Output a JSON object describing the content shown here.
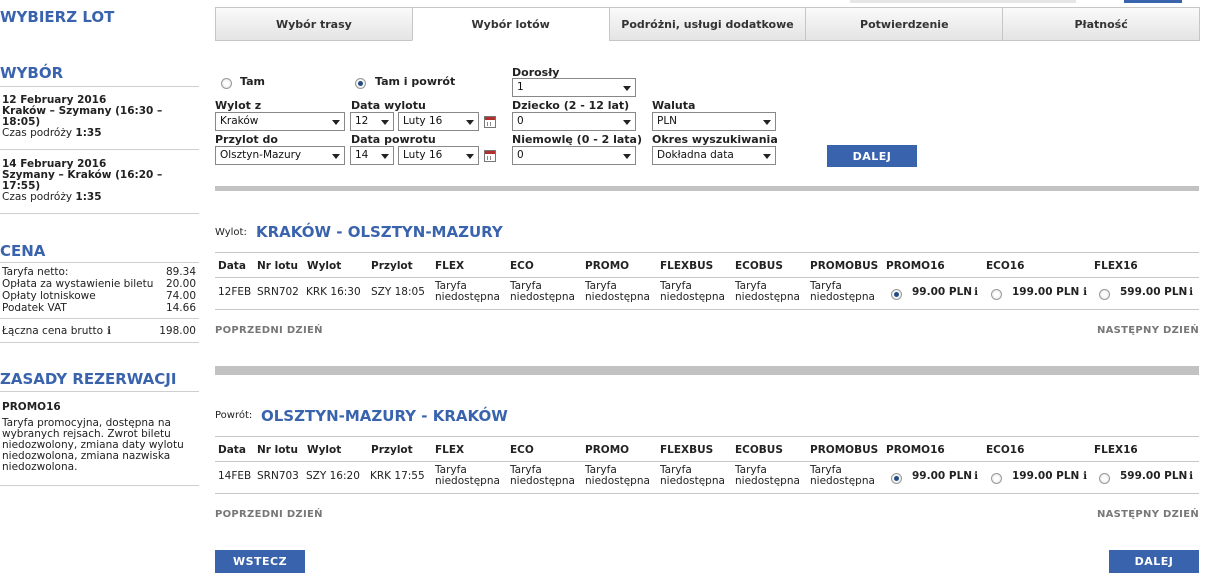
{
  "sidebar": {
    "title": "WYBIERZ LOT",
    "choice_heading": "WYBÓR",
    "legs": [
      {
        "date": "12 February 2016",
        "route": "Kraków – Szymany  (16:30 –",
        "route2": "18:05)",
        "duration_label": "Czas podróży",
        "duration": "1:35"
      },
      {
        "date": "14 February 2016",
        "route": "Szymany – Kraków  (16:20 –",
        "route2": "17:55)",
        "duration_label": "Czas podróży",
        "duration": "1:35"
      }
    ],
    "price_heading": "CENA",
    "price_rows": [
      {
        "label": "Taryfa netto:",
        "value": "89.34"
      },
      {
        "label": "Opłata za wystawienie biletu",
        "value": "20.00"
      },
      {
        "label": "Opłaty lotniskowe",
        "value": "74.00"
      },
      {
        "label": "Podatek VAT",
        "value": "14.66"
      }
    ],
    "total_label": "Łączna cena brutto",
    "total_value": "198.00",
    "rules_heading": "ZASADY REZERWACJI",
    "rules_fare": "PROMO16",
    "rules_text": [
      "Taryfa promocyjna, dostępna na",
      "wybranych rejsach. Zwrot biletu",
      "niedozwolony, zmiana daty wylotu",
      "niedozwolona, zmiana nazwiska",
      "niedozwolona."
    ]
  },
  "tabs": [
    "Wybór trasy",
    "Wybór lotów",
    "Podróżni, usługi dodatkowe",
    "Potwierdzenie",
    "Płatność"
  ],
  "active_tab": 1,
  "search": {
    "trip_oneway": "Tam",
    "trip_return": "Tam i powrót",
    "from_label": "Wylot z",
    "from_value": "Kraków",
    "to_label": "Przylot do",
    "to_value": "Olsztyn-Mazury",
    "dep_label": "Data wylotu",
    "dep_day": "12",
    "dep_month": "Luty 16",
    "ret_label": "Data powrotu",
    "ret_day": "14",
    "ret_month": "Luty 16",
    "adult_label": "Dorosły",
    "adult_value": "1",
    "child_label": "Dziecko (2 - 12 lat)",
    "child_value": "0",
    "infant_label": "Niemowlę (0 - 2 lata)",
    "infant_value": "0",
    "currency_label": "Waluta",
    "currency_value": "PLN",
    "period_label": "Okres wyszukiwania",
    "period_value": "Dokładna data",
    "submit": "DALEJ"
  },
  "columns": [
    "Data",
    "Nr lotu",
    "Wylot",
    "Przylot",
    "FLEX",
    "ECO",
    "PROMO",
    "FLEXBUS",
    "ECOBUS",
    "PROMOBUS",
    "PROMO16",
    "ECO16",
    "FLEX16"
  ],
  "unavailable": [
    "Taryfa",
    "niedostępna"
  ],
  "outbound": {
    "label": "Wylot:",
    "route": "KRAKÓW - OLSZTYN-MAZURY",
    "date": "12FEB",
    "flight": "SRN702",
    "dep": "KRK 16:30",
    "arr": "SZY 18:05",
    "prices": [
      "99.00 PLN",
      "199.00 PLN",
      "599.00 PLN"
    ],
    "selected": 0
  },
  "inbound": {
    "label": "Powrót:",
    "route": "OLSZTYN-MAZURY - KRAKÓW",
    "date": "14FEB",
    "flight": "SRN703",
    "dep": "SZY 16:20",
    "arr": "KRK 17:55",
    "prices": [
      "99.00 PLN",
      "199.00 PLN",
      "599.00 PLN"
    ],
    "selected": 0
  },
  "prev_day": "POPRZEDNI DZIEŃ",
  "next_day": "NASTĘPNY DZIEŃ",
  "back": "WSTECZ",
  "next": "DALEJ",
  "colors": {
    "accent": "#3a63ad",
    "separator": "#c2c2c2"
  }
}
